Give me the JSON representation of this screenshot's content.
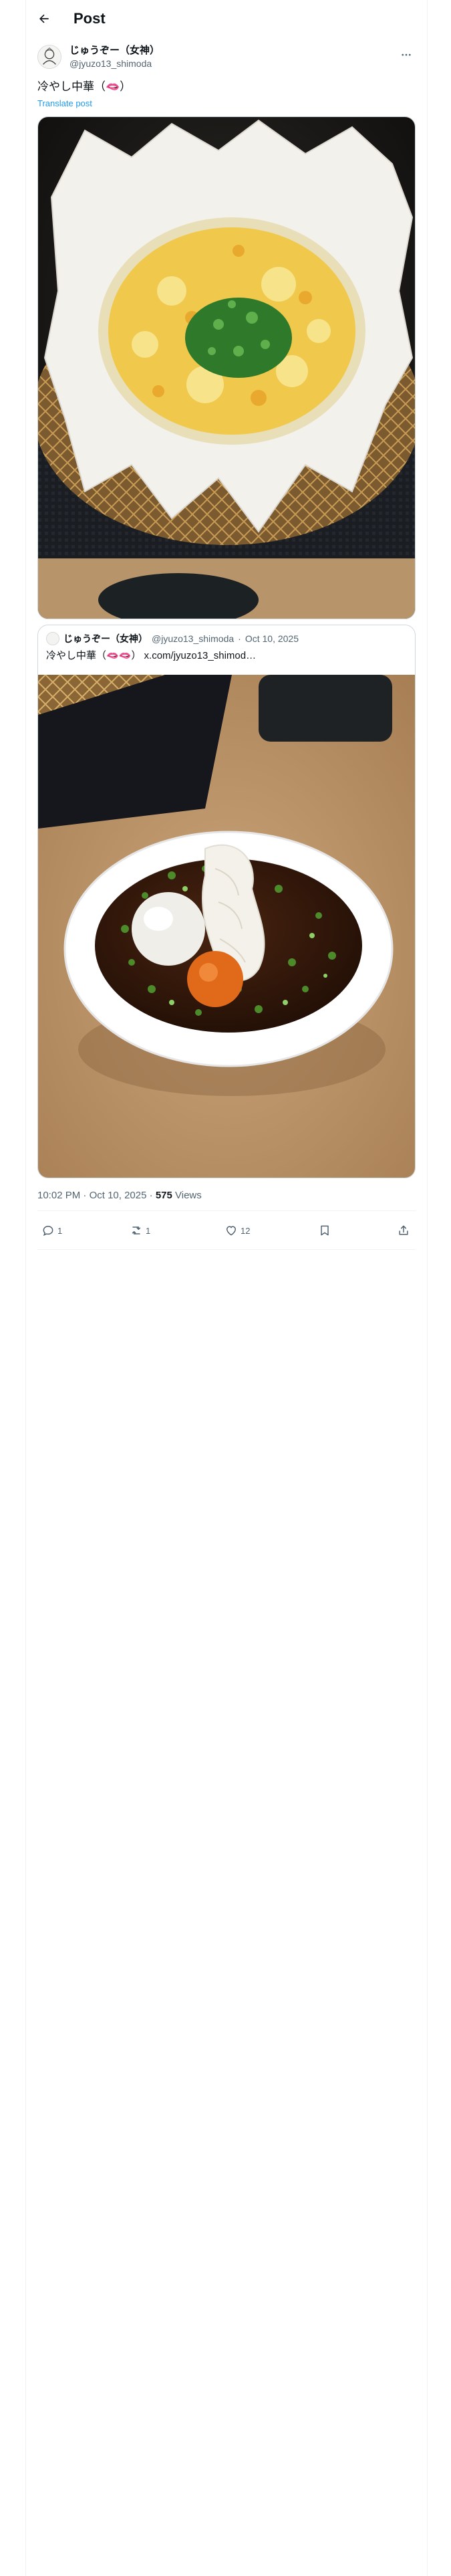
{
  "header": {
    "title": "Post",
    "back_icon": "arrow-left-icon"
  },
  "author": {
    "display_name": "じゅうぞー（女神）",
    "handle": "@jyuzo13_shimoda",
    "more_icon": "more-horizontal-icon"
  },
  "post": {
    "text": "冷やし中華（🫦）",
    "translate_label": "Translate post"
  },
  "quote": {
    "display_name": "じゅうぞー（女神）",
    "handle": "@jyuzo13_shimoda",
    "separator": "·",
    "date": "Oct 10, 2025",
    "text": "冷やし中華（🫦🫦） x.com/jyuzo13_shimod…"
  },
  "meta": {
    "time": "10:02 PM",
    "separator": "·",
    "date": "Oct 10, 2025",
    "separator2": "·",
    "views_count": "575",
    "views_label": "Views"
  },
  "actions": {
    "replies": "1",
    "reposts": "1",
    "likes": "12"
  },
  "colors": {
    "accent": "#1d9bf0",
    "secondary_text": "#536471",
    "border": "#cfd9de"
  }
}
